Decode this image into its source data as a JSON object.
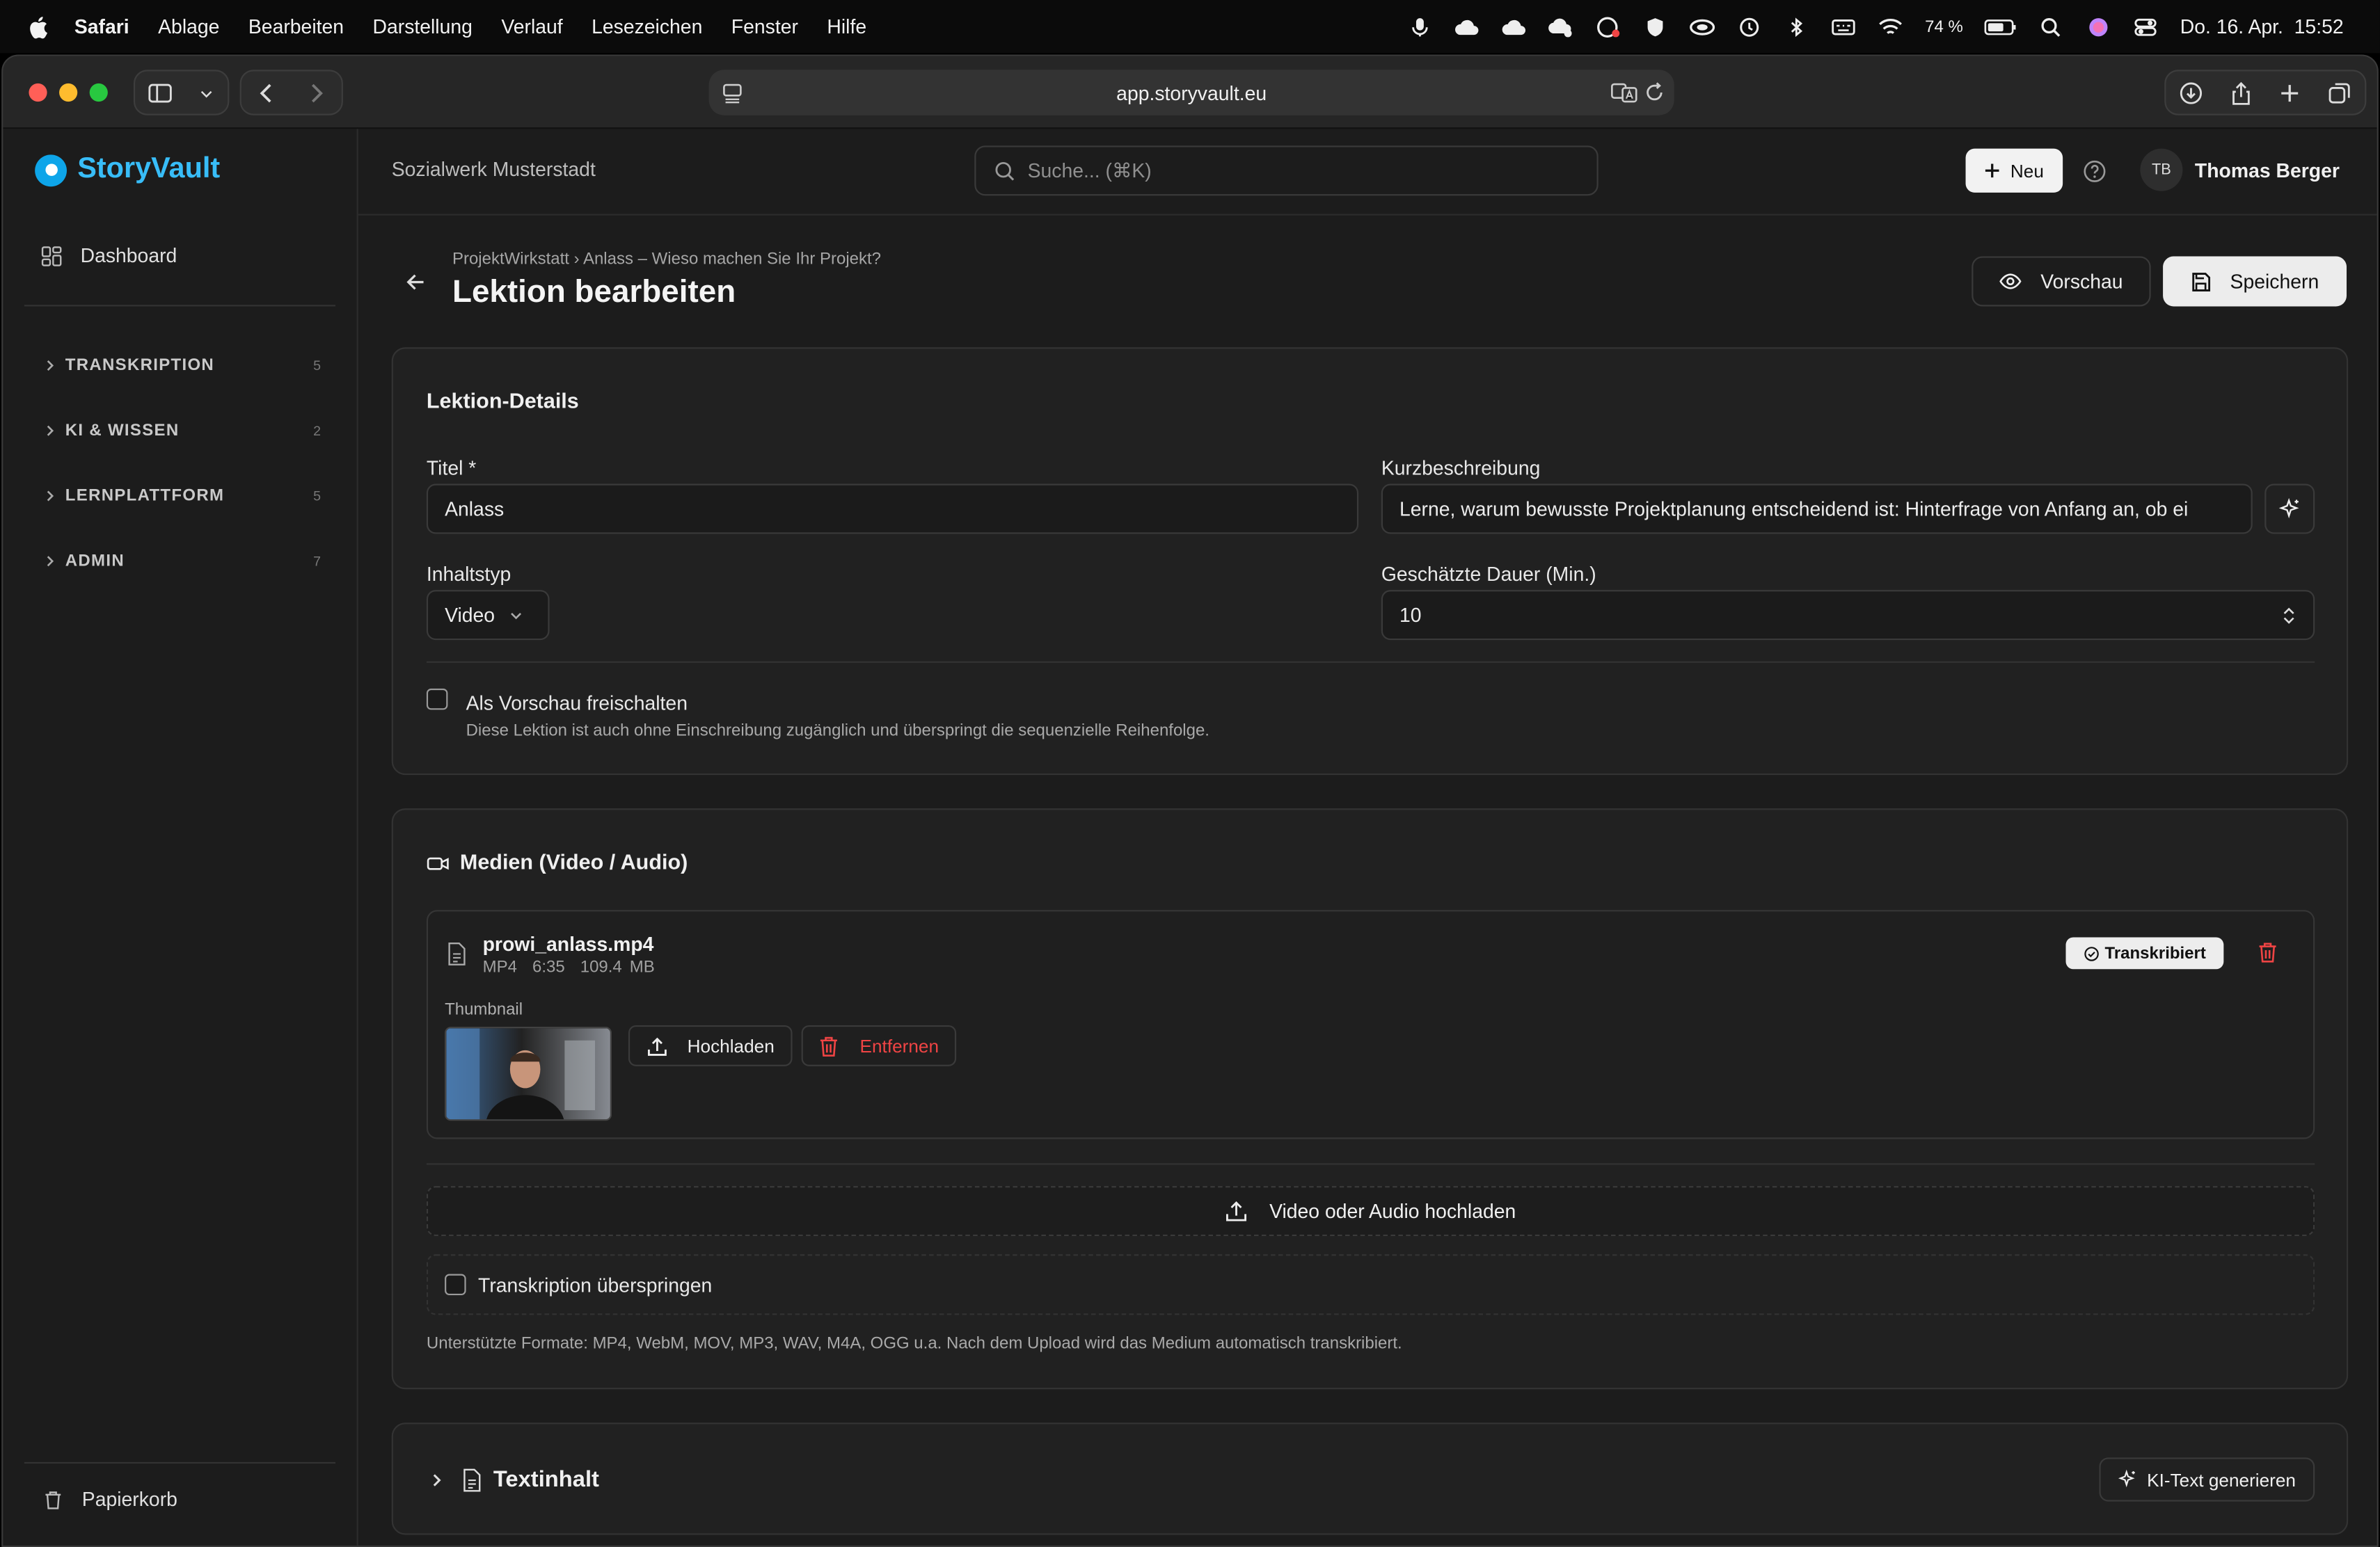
{
  "menubar": {
    "app": "Safari",
    "items": [
      "Ablage",
      "Bearbeiten",
      "Darstellung",
      "Verlauf",
      "Lesezeichen",
      "Fenster",
      "Hilfe"
    ],
    "battery": "74 %",
    "datetime": "Do. 16. Apr.  15:52"
  },
  "browser": {
    "url": "app.storyvault.eu"
  },
  "sidebar": {
    "logo": "StoryVault",
    "dashboard": "Dashboard",
    "groups": [
      {
        "label": "TRANSKRIPTION",
        "count": "5"
      },
      {
        "label": "KI & WISSEN",
        "count": "2"
      },
      {
        "label": "LERNPLATTFORM",
        "count": "5"
      },
      {
        "label": "ADMIN",
        "count": "7"
      }
    ],
    "trash": "Papierkorb"
  },
  "topbar": {
    "org": "Sozialwerk Musterstadt",
    "search_placeholder": "Suche... (⌘K)",
    "new_label": "Neu",
    "avatar": "TB",
    "user": "Thomas Berger"
  },
  "page": {
    "breadcrumb": "ProjektWirkstatt › Anlass – Wieso machen Sie Ihr Projekt?",
    "title": "Lektion bearbeiten",
    "preview_label": "Vorschau",
    "save_label": "Speichern"
  },
  "details": {
    "heading": "Lektion-Details",
    "title_label": "Titel *",
    "title_value": "Anlass",
    "short_label": "Kurzbeschreibung",
    "short_value": "Lerne, warum bewusste Projektplanung entscheidend ist: Hinterfrage von Anfang an, ob ei",
    "type_label": "Inhaltstyp",
    "type_value": "Video",
    "duration_label": "Geschätzte Dauer (Min.)",
    "duration_value": "10",
    "preview_checkbox": "Als Vorschau freischalten",
    "preview_hint": "Diese Lektion ist auch ohne Einschreibung zugänglich und überspringt die sequenzielle Reihenfolge."
  },
  "media": {
    "heading": "Medien (Video / Audio)",
    "file_name": "prowi_anlass.mp4",
    "file_meta": "MP4  6:35  109.4 MB",
    "status_badge": "Transkribiert",
    "thumbnail_label": "Thumbnail",
    "upload_label": "Hochladen",
    "remove_label": "Entfernen",
    "upload_media": "Video oder Audio hochladen",
    "skip_transcription": "Transkription überspringen",
    "formats_hint": "Unterstützte Formate: MP4, WebM, MOV, MP3, WAV, M4A, OGG u.a. Nach dem Upload wird das Medium automatisch transkribiert."
  },
  "text": {
    "heading": "Textinhalt",
    "ai_button": "KI-Text generieren"
  },
  "colors": {
    "brand": "#38bdf8",
    "danger": "#ef4444",
    "background": "#1c1c1c"
  }
}
